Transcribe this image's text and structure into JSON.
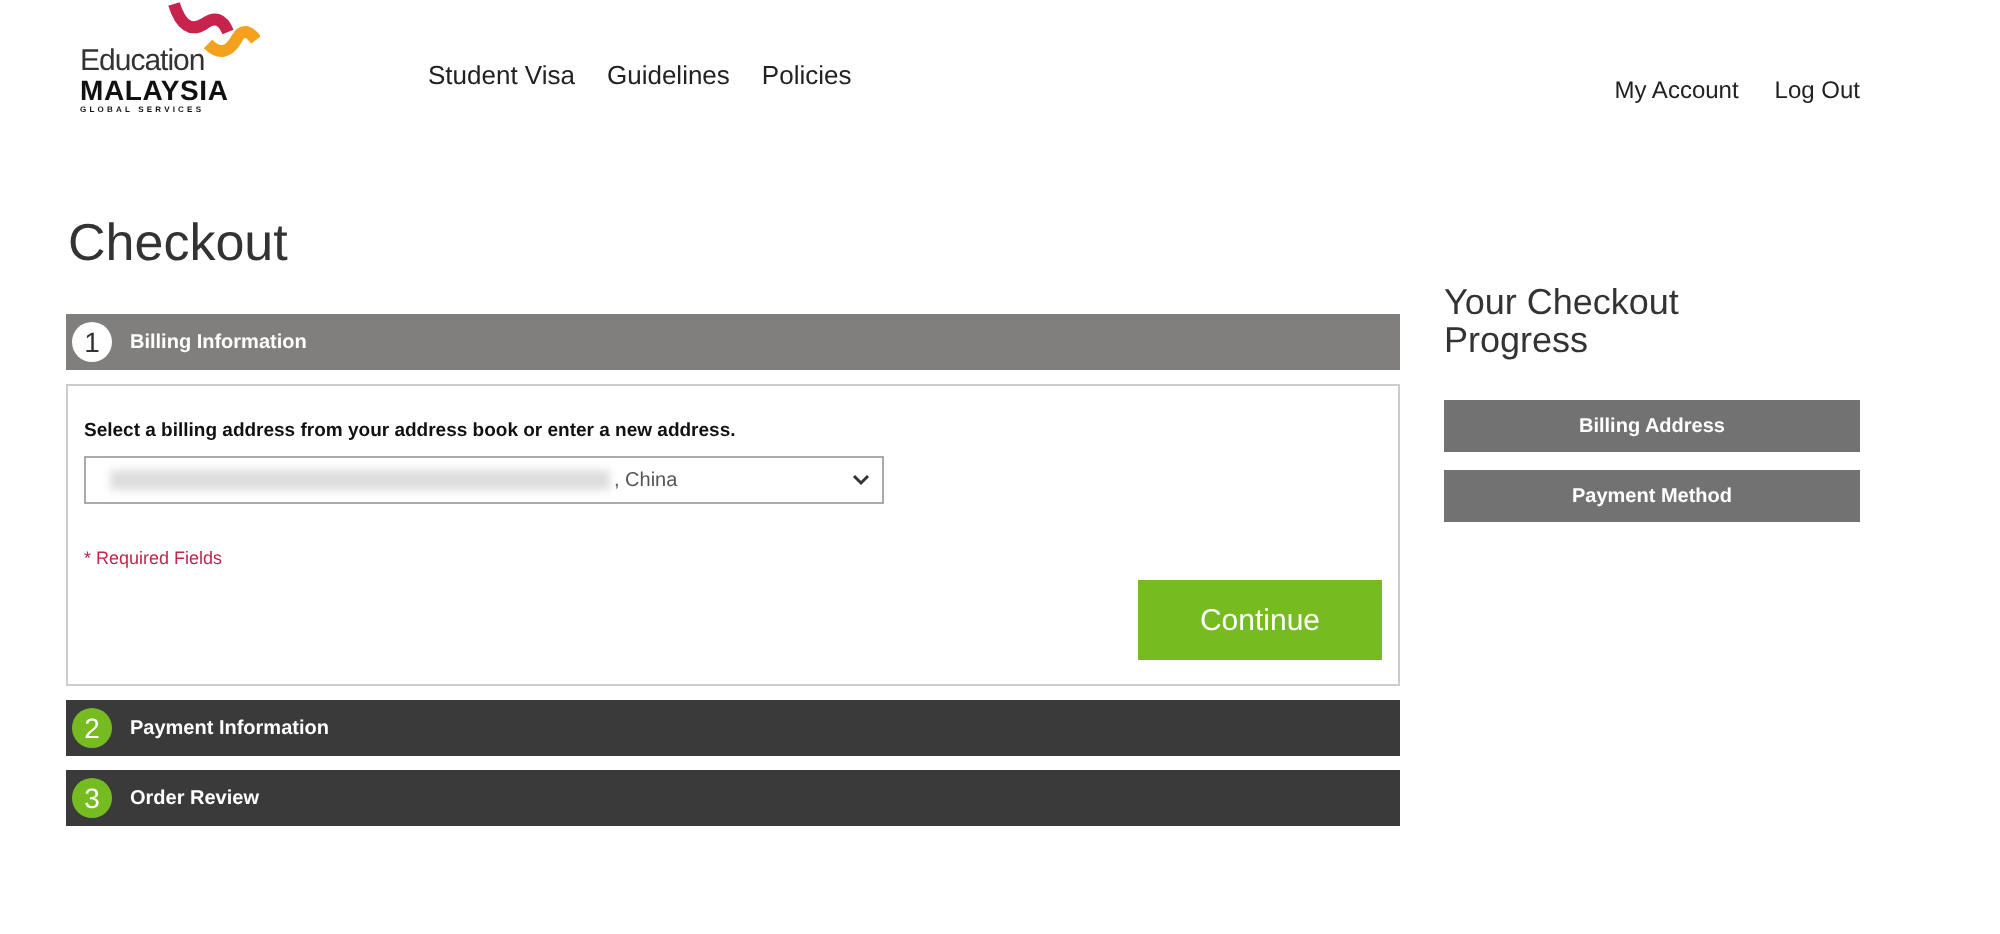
{
  "logo": {
    "line_1": "Education",
    "line_2": "MALAYSIA",
    "line_3": "GLOBAL SERVICES"
  },
  "nav": [
    "Student Visa",
    "Guidelines",
    "Policies"
  ],
  "account_links": [
    "My Account",
    "Log Out"
  ],
  "page_title": "Checkout",
  "steps": [
    {
      "number": "1",
      "title": "Billing Information",
      "expanded": true
    },
    {
      "number": "2",
      "title": "Payment Information",
      "expanded": false
    },
    {
      "number": "3",
      "title": "Order Review",
      "expanded": false
    }
  ],
  "billing": {
    "instruction": "Select a billing address from your address book or enter a new address.",
    "address_select": ", China",
    "required_note": "* Required Fields",
    "continue_button": "Continue"
  },
  "progress": {
    "title": "Your Checkout Progress",
    "items": [
      "Billing Address",
      "Payment Method"
    ]
  }
}
